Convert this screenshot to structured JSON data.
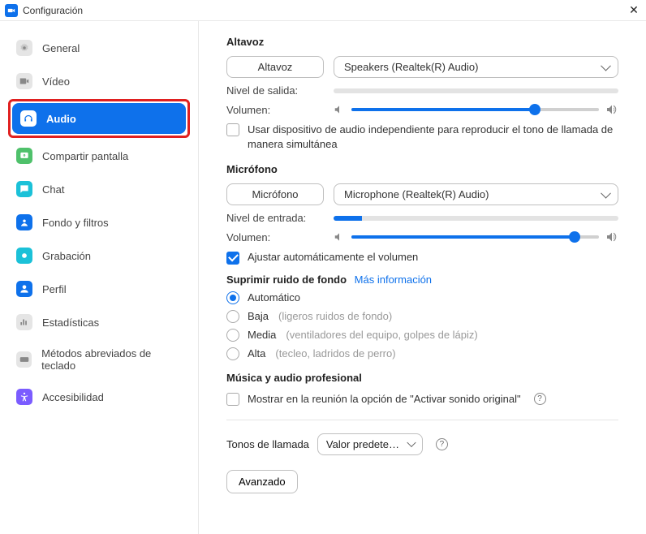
{
  "titlebar": {
    "title": "Configuración"
  },
  "sidebar": {
    "items": [
      {
        "label": "General"
      },
      {
        "label": "Vídeo"
      },
      {
        "label": "Audio"
      },
      {
        "label": "Compartir pantalla"
      },
      {
        "label": "Chat"
      },
      {
        "label": "Fondo y filtros"
      },
      {
        "label": "Grabación"
      },
      {
        "label": "Perfil"
      },
      {
        "label": "Estadísticas"
      },
      {
        "label": "Métodos abreviados de teclado"
      },
      {
        "label": "Accesibilidad"
      }
    ]
  },
  "speaker": {
    "heading": "Altavoz",
    "test_label": "Altavoz",
    "device": "Speakers (Realtek(R) Audio)",
    "output_level_label": "Nivel de salida:",
    "volume_label": "Volumen:",
    "volume_percent": 74,
    "separate_device_label": "Usar dispositivo de audio independiente para reproducir el tono de llamada de manera simultánea"
  },
  "mic": {
    "heading": "Micrófono",
    "test_label": "Micrófono",
    "device": "Microphone (Realtek(R) Audio)",
    "input_level_label": "Nivel de entrada:",
    "input_level_percent": 10,
    "volume_label": "Volumen:",
    "volume_percent": 90,
    "auto_adjust_label": "Ajustar automáticamente el volumen"
  },
  "noise": {
    "heading": "Suprimir ruido de fondo",
    "more_info": "Más información",
    "options": [
      {
        "label": "Automático",
        "hint": ""
      },
      {
        "label": "Baja",
        "hint": "(ligeros ruidos de fondo)"
      },
      {
        "label": "Media",
        "hint": "(ventiladores del equipo, golpes de lápiz)"
      },
      {
        "label": "Alta",
        "hint": "(tecleo, ladridos de perro)"
      }
    ]
  },
  "pro_audio": {
    "heading": "Música y audio profesional",
    "original_sound_label": "Mostrar en la reunión la opción de \"Activar sonido original\""
  },
  "ringtone": {
    "label": "Tonos de llamada",
    "value": "Valor predete…"
  },
  "advanced_label": "Avanzado"
}
